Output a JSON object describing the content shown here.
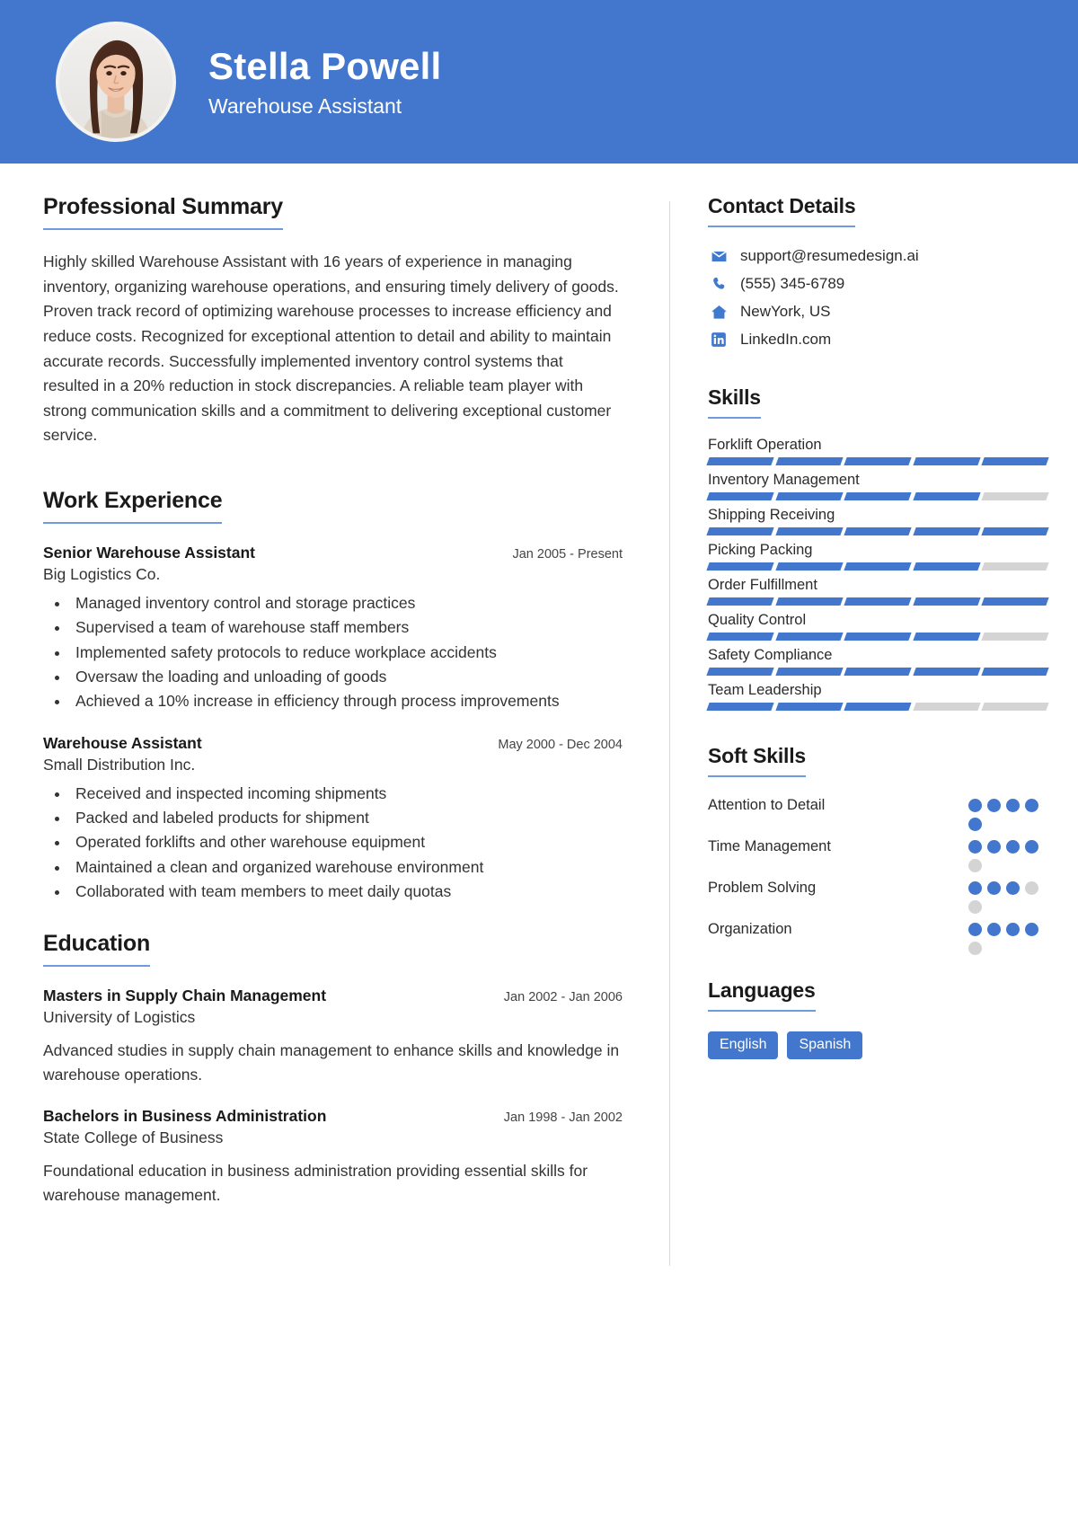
{
  "theme": {
    "accent": "#4277cd",
    "accent_light": "#6f9bdc",
    "muted": "#d4d4d4",
    "text": "#2b2b2b"
  },
  "header": {
    "name": "Stella Powell",
    "job_title": "Warehouse Assistant",
    "avatar_alt": "portrait-photo"
  },
  "summary": {
    "heading": "Professional Summary",
    "text": "Highly skilled Warehouse Assistant with 16 years of experience in managing inventory, organizing warehouse operations, and ensuring timely delivery of goods. Proven track record of optimizing warehouse processes to increase efficiency and reduce costs. Recognized for exceptional attention to detail and ability to maintain accurate records. Successfully implemented inventory control systems that resulted in a 20% reduction in stock discrepancies. A reliable team player with strong communication skills and a commitment to delivering exceptional customer service."
  },
  "work_experience": {
    "heading": "Work Experience",
    "entries": [
      {
        "role": "Senior Warehouse Assistant",
        "company": "Big Logistics Co.",
        "date": "Jan 2005 - Present",
        "bullets": [
          "Managed inventory control and storage practices",
          "Supervised a team of warehouse staff members",
          "Implemented safety protocols to reduce workplace accidents",
          "Oversaw the loading and unloading of goods",
          "Achieved a 10% increase in efficiency through process improvements"
        ]
      },
      {
        "role": "Warehouse Assistant",
        "company": "Small Distribution Inc.",
        "date": "May 2000 - Dec 2004",
        "bullets": [
          "Received and inspected incoming shipments",
          "Packed and labeled products for shipment",
          "Operated forklifts and other warehouse equipment",
          "Maintained a clean and organized warehouse environment",
          "Collaborated with team members to meet daily quotas"
        ]
      }
    ]
  },
  "education": {
    "heading": "Education",
    "entries": [
      {
        "degree": "Masters in Supply Chain Management",
        "school": "University of Logistics",
        "date": "Jan 2002 - Jan 2006",
        "description": "Advanced studies in supply chain management to enhance skills and knowledge in warehouse operations."
      },
      {
        "degree": "Bachelors in Business Administration",
        "school": "State College of Business",
        "date": "Jan 1998 - Jan 2002",
        "description": "Foundational education in business administration providing essential skills for warehouse management."
      }
    ]
  },
  "contact": {
    "heading": "Contact Details",
    "items": [
      {
        "icon": "envelope-icon",
        "value": "support@resumedesign.ai"
      },
      {
        "icon": "phone-icon",
        "value": "(555) 345-6789"
      },
      {
        "icon": "home-icon",
        "value": "NewYork, US"
      },
      {
        "icon": "linkedin-icon",
        "value": "LinkedIn.com"
      }
    ]
  },
  "skills": {
    "heading": "Skills",
    "segments_total": 5,
    "items": [
      {
        "name": "Forklift Operation",
        "filled": 5
      },
      {
        "name": "Inventory Management",
        "filled": 4
      },
      {
        "name": "Shipping Receiving",
        "filled": 5
      },
      {
        "name": "Picking Packing",
        "filled": 4
      },
      {
        "name": "Order Fulfillment",
        "filled": 5
      },
      {
        "name": "Quality Control",
        "filled": 4
      },
      {
        "name": "Safety Compliance",
        "filled": 5
      },
      {
        "name": "Team Leadership",
        "filled": 3
      }
    ]
  },
  "soft_skills": {
    "heading": "Soft Skills",
    "dots_total": 5,
    "items": [
      {
        "name": "Attention to Detail",
        "filled": 5
      },
      {
        "name": "Time Management",
        "filled": 4
      },
      {
        "name": "Problem Solving",
        "filled": 3
      },
      {
        "name": "Organization",
        "filled": 4
      }
    ]
  },
  "languages": {
    "heading": "Languages",
    "items": [
      "English",
      "Spanish"
    ]
  }
}
